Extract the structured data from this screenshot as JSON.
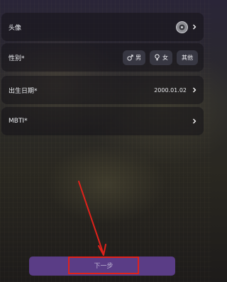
{
  "form": {
    "avatar": {
      "label": "头像"
    },
    "gender": {
      "label": "性别*",
      "options": [
        {
          "label": "男",
          "icon": "male-icon"
        },
        {
          "label": "女",
          "icon": "female-icon"
        },
        {
          "label": "其他"
        }
      ]
    },
    "birthday": {
      "label": "出生日期*",
      "value": "2000.01.02"
    },
    "mbti": {
      "label": "MBTI*"
    }
  },
  "footer": {
    "next_label": "下一步"
  },
  "colors": {
    "next_button": "#5a3d86",
    "annotation": "#e0221b"
  }
}
